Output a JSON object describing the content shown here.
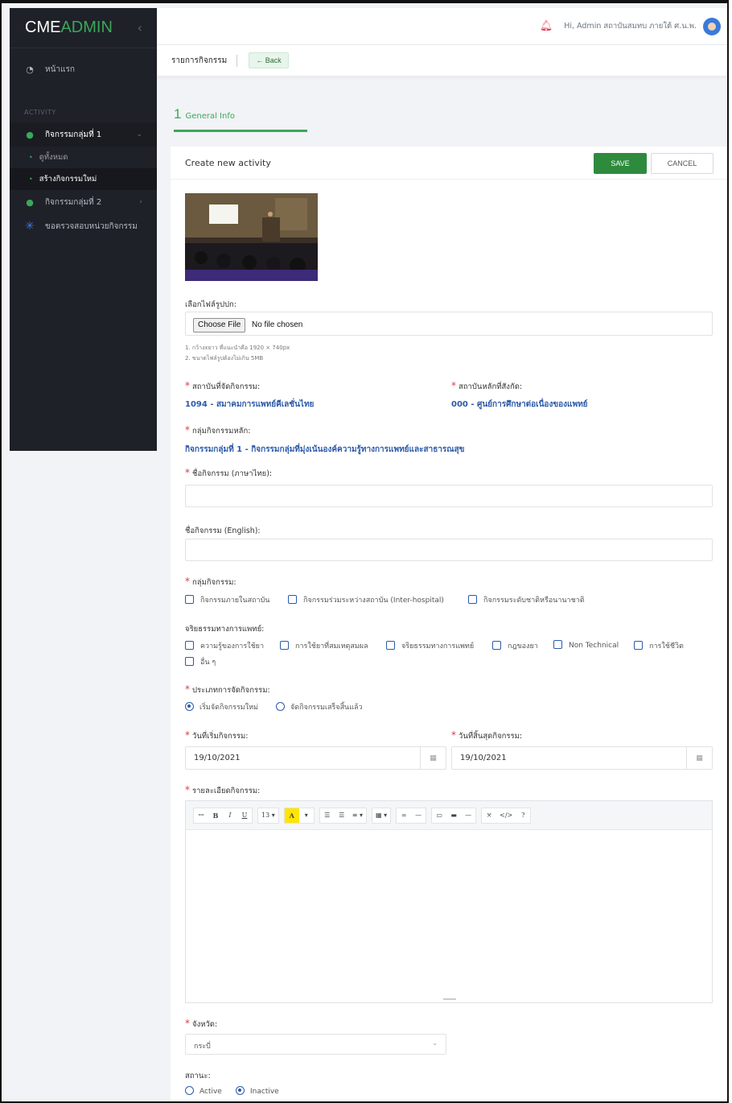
{
  "sidebar": {
    "logo_cme": "CME",
    "logo_admin": "ADMIN",
    "collapse_icon": "chevron-left-icon",
    "home": "หน้าแรก",
    "section": "ACTIVITY",
    "group1": "กิจกรรมกลุ่มที่ 1",
    "group1_sub": [
      "ดูทั้งหมด",
      "สร้างกิจกรรมใหม่"
    ],
    "group2": "กิจกรรมกลุ่มที่ 2",
    "review": "ขอตรวจสอบหน่วยกิจกรรม"
  },
  "topbar": {
    "greeting": "Hi,  Admin สถาบันสมทบ ภายใต้ ศ.น.พ.",
    "accent": "#e0384a"
  },
  "subbar": {
    "crumb": "รายการกิจกรรม",
    "back": "← Back"
  },
  "step": {
    "number": "1",
    "label": "General Info"
  },
  "card": {
    "title": "Create new activity",
    "save": "SAVE",
    "cancel": "CANCEL",
    "cover_label": "เลือกไฟล์รูปปก:",
    "file_button": "Choose File",
    "file_status": "No file chosen",
    "hint1": "1. กว้างxยาว ที่แนะนำคือ 1920 × 740px",
    "hint2": "2. ขนาดไฟล์รูปต้องไม่เกิน 5MB",
    "inst_label": "สถาบันที่จัดกิจกรรม:",
    "inst_value": "1094 - สมาคมการแพทย์คีเลชั่นไทย",
    "parent_label": "สถาบันหลักที่สังกัด:",
    "parent_value": "000 - ศูนย์การศึกษาต่อเนื่องของแพทย์",
    "main_group_label": "กลุ่มกิจกรรมหลัก:",
    "main_group_value": "กิจกรรมกลุ่มที่ 1 - กิจกรรมกลุ่มที่มุ่งเน้นองค์ความรู้ทางการแพทย์และสาธารณสุข",
    "name_th_label": "ชื่อกิจกรรม (ภาษาไทย):",
    "name_th_value": "",
    "name_en_label": "ชื่อกิจกรรม (English):",
    "name_en_value": "",
    "group_label": "กลุ่มกิจกรรม:",
    "group_options": [
      "กิจกรรมภายในสถาบัน",
      "กิจกรรมร่วมระหว่างสถาบัน (Inter-hospital)",
      "กิจกรรมระดับชาติหรือนานาชาติ"
    ],
    "ethics_label": "จริยธรรมทางการแพทย์:",
    "ethics_options": [
      "ความรู้ของการใช้ยา",
      "การใช้ยาที่สมเหตุสมผล",
      "จริยธรรมทางการแพทย์",
      "กฎของยา",
      "Non Technical",
      "การใช้ชีวิต",
      "อื่น ๆ"
    ],
    "type_label": "ประเภทการจัดกิจกรรม:",
    "type_options": [
      "เริ่มจัดกิจกรรมใหม่",
      "จัดกิจกรรมเสร็จสิ้นแล้ว"
    ],
    "type_selected": 0,
    "start_label": "วันที่เริ่มกิจกรรม:",
    "start_value": "19/10/2021",
    "end_label": "วันที่สิ้นสุดกิจกรรม:",
    "end_value": "19/10/2021",
    "detail_label": "รายละเอียดกิจกรรม:",
    "toolbar": [
      "ꟷ",
      "B",
      "I",
      "U",
      "13 ▾",
      "A",
      "▾",
      "☰",
      "☰",
      "≡ ▾",
      "▦ ▾",
      "∞",
      "—",
      "▭",
      "▬",
      "—",
      "⤧",
      "</>",
      "?"
    ],
    "province_label": "จังหวัด:",
    "province_value": "กระบี่",
    "status_label": "สถานะ:",
    "status_options": [
      "Active",
      "Inactive"
    ],
    "status_selected": 1,
    "brand_green": "#3aa85a",
    "link_blue": "#2c5aa8"
  }
}
